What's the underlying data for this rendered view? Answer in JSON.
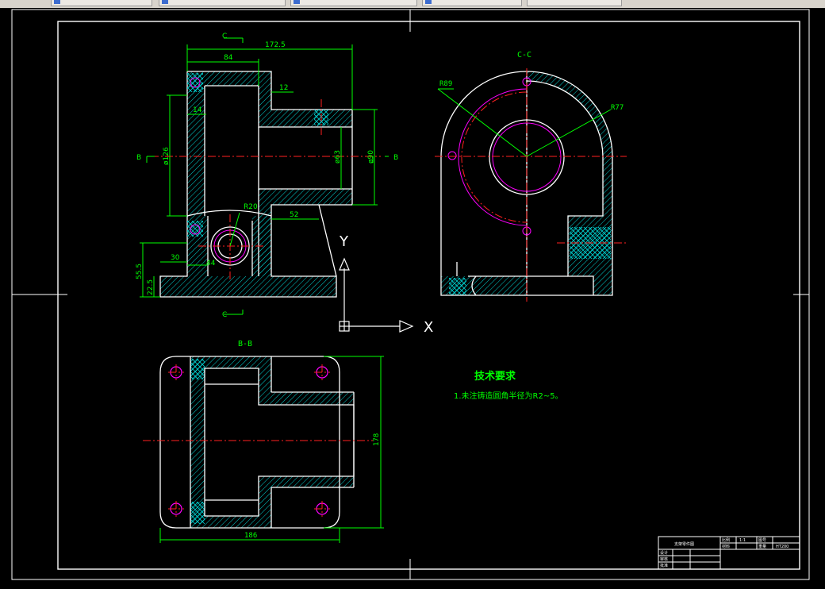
{
  "topbar": {
    "tabs": [
      {
        "label": "",
        "icon": "drawing-icon"
      },
      {
        "label": "",
        "icon": "drawing-icon"
      },
      {
        "label": "",
        "icon": "drawing-icon"
      },
      {
        "label": "",
        "icon": "drawing-icon"
      },
      {
        "label": ""
      }
    ]
  },
  "colors": {
    "background": "#000000",
    "outline": "#ffffff",
    "dimension": "#00ff00",
    "hatch": "#00e5e5",
    "centerline": "#ff2020",
    "circle": "#ff00ff",
    "ucs": "#ffffff"
  },
  "views": {
    "front": {
      "section_mark": "C",
      "side_mark": "B",
      "dims": {
        "overall_width": "172.5",
        "upper_width": "84",
        "flange_step": "12",
        "wall": "14",
        "bore_dia": "ø126",
        "boss_inner": "ø63",
        "boss_outer": "ø90",
        "radius": "R20",
        "foot_len": "52",
        "left_offset": "30",
        "slot": "44",
        "height": "55.5",
        "base_h": "22.5"
      }
    },
    "side": {
      "title": "C-C",
      "radius_outer": "R89",
      "radius_inner": "R77"
    },
    "top": {
      "title": "B-B",
      "width": "186",
      "height": "178"
    }
  },
  "ucs": {
    "x_label": "X",
    "y_label": "Y"
  },
  "notes": {
    "title": "技术要求",
    "line1": "1.未注铸造圆角半径为R2~5。"
  },
  "title_block": {
    "part_name": "支架零件图",
    "scale_label": "比例",
    "scale_value": "1:1",
    "material_label": "材料",
    "qty_label": "数量",
    "sheet_label": "图号",
    "weight_label": "重量",
    "drawing_no": "HT200",
    "designer_label": "设计",
    "checker_label": "审核",
    "approve_label": "批准"
  }
}
